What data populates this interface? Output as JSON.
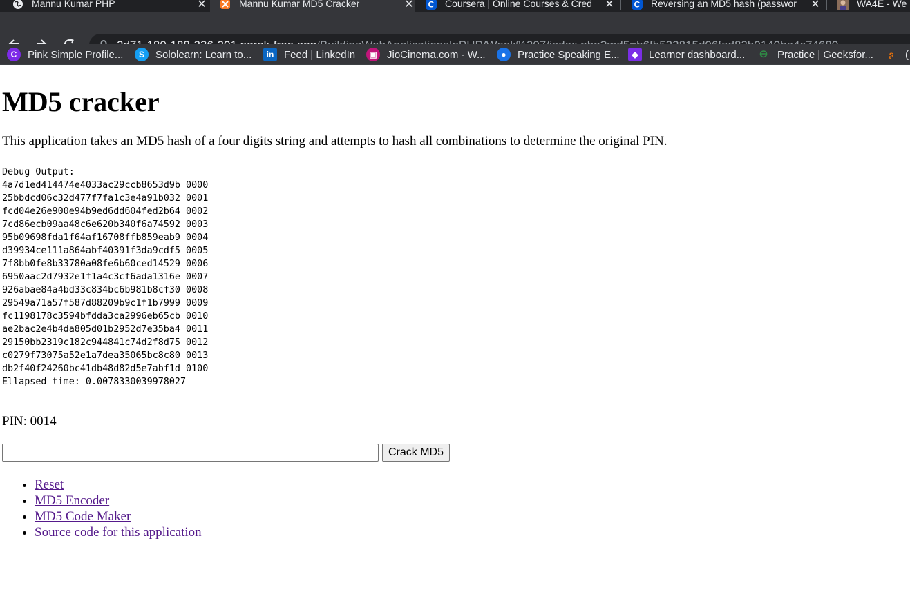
{
  "browser": {
    "tabs": [
      {
        "title": "Mannu Kumar PHP",
        "icon": "world-icon",
        "active": false
      },
      {
        "title": "Mannu Kumar MD5 Cracker",
        "icon": "xampp-icon",
        "active": true
      },
      {
        "title": "Coursera | Online Courses & Cred",
        "icon": "coursera-icon",
        "active": false
      },
      {
        "title": "Reversing an MD5 hash (passwor",
        "icon": "coursera-icon",
        "active": false
      },
      {
        "title": "WA4E - We",
        "icon": "avatar-icon",
        "active": false
      }
    ],
    "url_host": "2d71-180-188-236-201.ngrok-free.app",
    "url_path": "/BuildingWebApplicationsInPHP/Week%207/index.php?md5=b6fb522815d06fed82b0140be4c74680",
    "bookmarks": [
      {
        "label": "Pink Simple Profile...",
        "icon": "canva-icon",
        "color": "#7d2ae8"
      },
      {
        "label": "Sololearn: Learn to...",
        "icon": "sololearn-icon",
        "color": "#149ef2"
      },
      {
        "label": "Feed | LinkedIn",
        "icon": "linkedin-icon",
        "color": "#0a66c2"
      },
      {
        "label": "JioCinema.com - W...",
        "icon": "jiocinema-icon",
        "color": "#c1157a"
      },
      {
        "label": "Practice Speaking E...",
        "icon": "practice-speaking-icon",
        "color": "#1a73e8"
      },
      {
        "label": "Learner dashboard...",
        "icon": "learner-shield-icon",
        "color": "#7b2ee6"
      },
      {
        "label": "Practice | Geeksfor...",
        "icon": "geeksforgeeks-icon",
        "color": "#2f8d46"
      },
      {
        "label": "(",
        "icon": "partial-bookmark-icon",
        "color": "#e8710a"
      }
    ]
  },
  "page": {
    "title": "MD5 cracker",
    "intro": "This application takes an MD5 hash of a four digits string and attempts to hash all combinations to determine the original PIN.",
    "debug_lines": [
      "Debug Output:",
      "4a7d1ed414474e4033ac29ccb8653d9b 0000",
      "25bbdcd06c32d477f7fa1c3e4a91b032 0001",
      "fcd04e26e900e94b9ed6dd604fed2b64 0002",
      "7cd86ecb09aa48c6e620b340f6a74592 0003",
      "95b09698fda1f64af16708ffb859eab9 0004",
      "d39934ce111a864abf40391f3da9cdf5 0005",
      "7f8bb0fe8b33780a08fe6b60ced14529 0006",
      "6950aac2d7932e1f1a4c3cf6ada1316e 0007",
      "926abae84a4bd33c834bc6b981b8cf30 0008",
      "29549a71a57f587d88209b9c1f1b7999 0009",
      "fc1198178c3594bfdda3ca2996eb65cb 0010",
      "ae2bac2e4b4da805d01b2952d7e35ba4 0011",
      "29150bb2319c182c944841c74d2f8d75 0012",
      "c0279f73075a52e1a7dea35065bc8c80 0013",
      "db2f40f24260bc41db48d82d5e7abf1d 0100",
      "Ellapsed time: 0.0078330039978027"
    ],
    "pin_text": "PIN: 0014",
    "md5_input_value": "",
    "crack_button": "Crack MD5",
    "links": [
      "Reset",
      "MD5 Encoder",
      "MD5 Code Maker",
      "Source code for this application"
    ]
  }
}
